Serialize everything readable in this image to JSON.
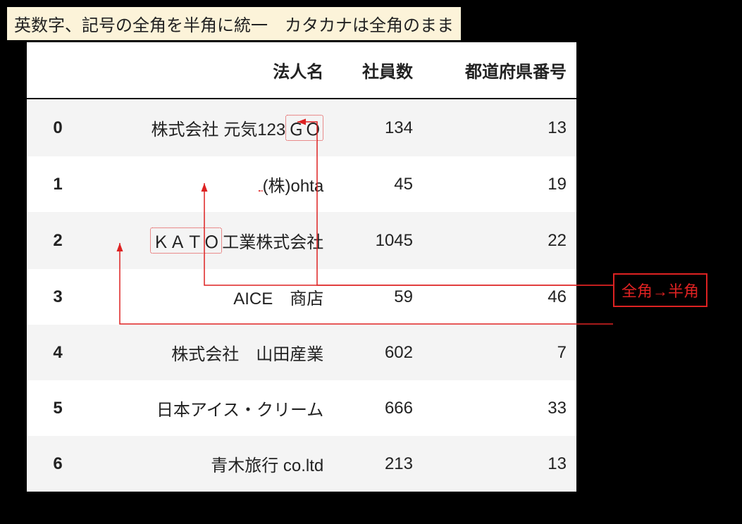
{
  "banner": "英数字、記号の全角を半角に統一　カタカナは全角のまま",
  "headers": {
    "col1": "法人名",
    "col2": "社員数",
    "col3": "都道府県番号"
  },
  "rows": [
    {
      "idx": "0",
      "name_pre": "株式会社 元気123",
      "name_hl": "ＧＯ",
      "name_post": "",
      "emp": "134",
      "pref": "13"
    },
    {
      "idx": "1",
      "name_pre": "",
      "name_hl": " ",
      "name_post": "(株)ohta",
      "emp": "45",
      "pref": "19"
    },
    {
      "idx": "2",
      "name_pre": "",
      "name_hl": "ＫＡＴＯ",
      "name_post": "工業株式会社",
      "emp": "1045",
      "pref": "22"
    },
    {
      "idx": "3",
      "name_pre": "AICE　商店",
      "name_hl": "",
      "name_post": "",
      "emp": "59",
      "pref": "46"
    },
    {
      "idx": "4",
      "name_pre": "株式会社　山田産業",
      "name_hl": "",
      "name_post": "",
      "emp": "602",
      "pref": "7"
    },
    {
      "idx": "5",
      "name_pre": "日本アイス・クリーム",
      "name_hl": "",
      "name_post": "",
      "emp": "666",
      "pref": "33"
    },
    {
      "idx": "6",
      "name_pre": "青木旅行 co.ltd",
      "name_hl": "",
      "name_post": "",
      "emp": "213",
      "pref": "13"
    }
  ],
  "callout": "全角→半角"
}
